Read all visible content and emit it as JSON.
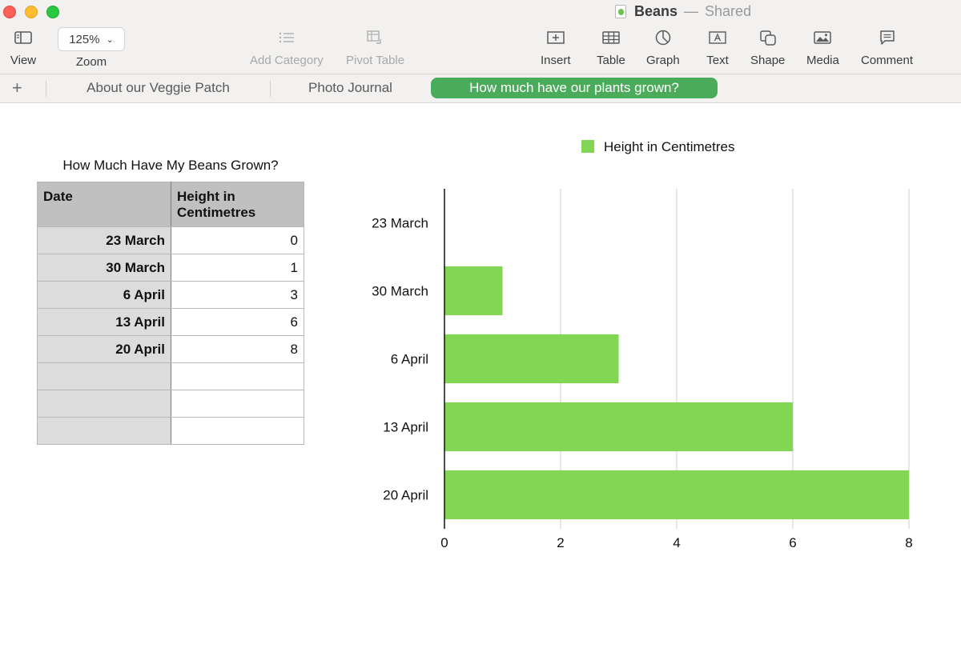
{
  "window": {
    "doc_name": "Beans",
    "separator": "—",
    "status": "Shared"
  },
  "toolbar": {
    "view_label": "View",
    "zoom_value": "125%",
    "zoom_label": "Zoom",
    "add_category_label": "Add Category",
    "pivot_table_label": "Pivot Table",
    "insert_label": "Insert",
    "table_label": "Table",
    "graph_label": "Graph",
    "text_label": "Text",
    "shape_label": "Shape",
    "media_label": "Media",
    "comment_label": "Comment"
  },
  "tabs": {
    "add_symbol": "+",
    "items": [
      {
        "label": "About our Veggie Patch"
      },
      {
        "label": "Photo Journal"
      },
      {
        "label": "How much have our plants grown?"
      }
    ],
    "active_index": 2
  },
  "table": {
    "title": "How Much Have My Beans Grown?",
    "headers": [
      "Date",
      "Height in Centimetres"
    ],
    "rows": [
      [
        "23 March",
        "0"
      ],
      [
        "30 March",
        "1"
      ],
      [
        "6 April",
        "3"
      ],
      [
        "13 April",
        "6"
      ],
      [
        "20 April",
        "8"
      ],
      [
        "",
        ""
      ],
      [
        "",
        ""
      ],
      [
        "",
        ""
      ]
    ]
  },
  "colors": {
    "bar": "#82d653",
    "active_tab": "#4aab5a"
  },
  "chart_data": {
    "type": "bar",
    "orientation": "horizontal",
    "categories": [
      "23 March",
      "30 March",
      "6 April",
      "13 April",
      "20 April"
    ],
    "series": [
      {
        "name": "Height in Centimetres",
        "values": [
          0,
          1,
          3,
          6,
          8
        ]
      }
    ],
    "xlim": [
      0,
      8
    ],
    "x_ticks": [
      "0",
      "2",
      "4",
      "6",
      "8"
    ],
    "grid": "vertical",
    "legend_position": "top"
  }
}
